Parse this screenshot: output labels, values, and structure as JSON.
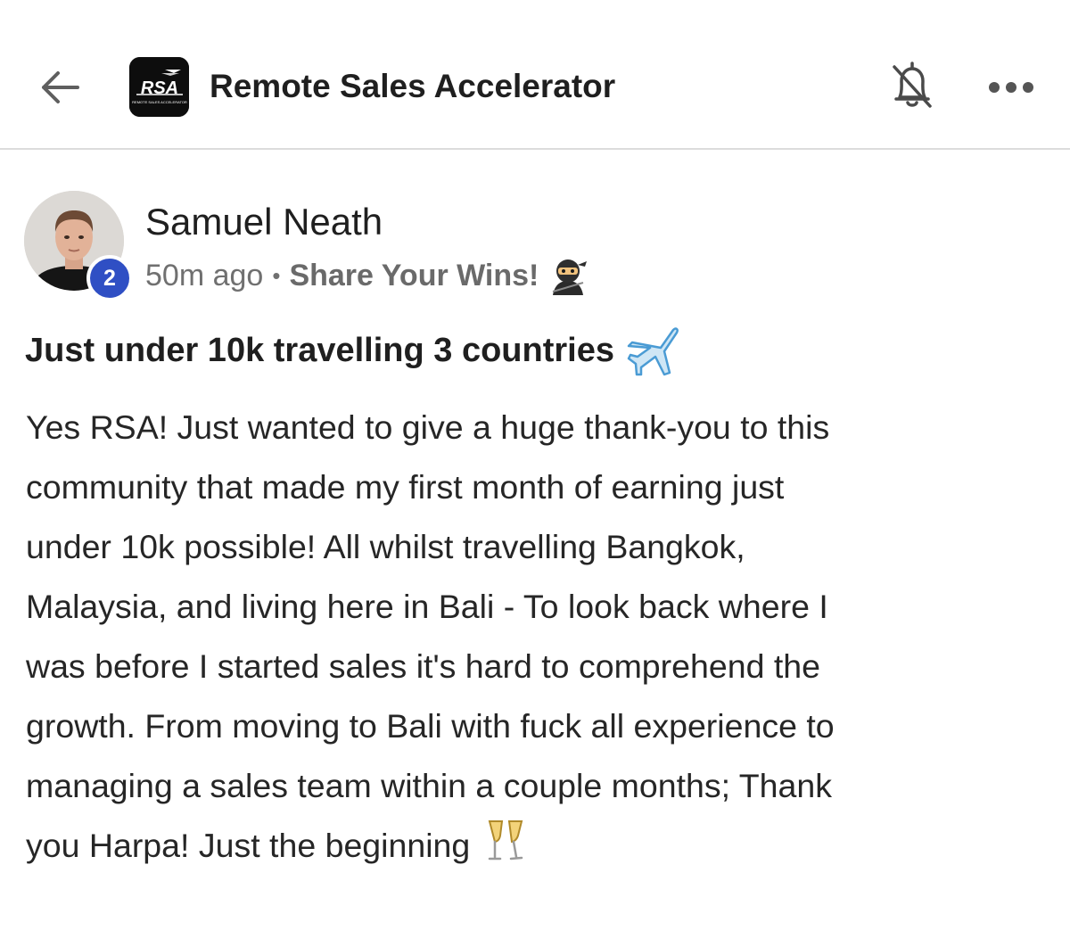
{
  "header": {
    "back_icon": "arrow-left-icon",
    "group_name": "Remote Sales Accelerator",
    "logo": {
      "text": "RSA",
      "subtext": "REMOTE SALES ACCELERATOR",
      "background": "#0d0d0d"
    },
    "bell_icon": "bell-off-icon",
    "more_icon": "more-horizontal-icon"
  },
  "post": {
    "author": {
      "name": "Samuel Neath",
      "level": "2"
    },
    "time_ago": "50m ago",
    "separator": "•",
    "category": "Share Your Wins!",
    "category_icon": "ninja-emoji-icon",
    "title": "Just under 10k travelling 3 countries",
    "title_icon": "airplane-emoji-icon",
    "body_lines": [
      "Yes RSA! Just wanted to give a huge thank-you to this",
      "community that made my first month of earning just",
      "under 10k possible! All whilst travelling Bangkok,",
      "Malaysia, and living here in Bali - To look back where I",
      "was before I started sales it's hard to comprehend the",
      "growth. From moving to Bali with fuck all experience to",
      "managing a sales team within a couple months; Thank",
      "you Harpa! Just the beginning"
    ],
    "end_icon": "champagne-emoji-icon"
  },
  "colors": {
    "level_badge": "#2f4fc4",
    "divider": "#dcdcdc",
    "meta_text": "#707070"
  }
}
